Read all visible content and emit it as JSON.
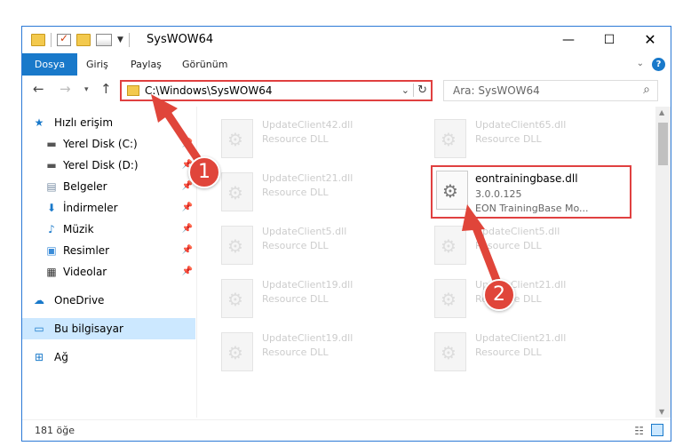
{
  "window": {
    "title": "SysWOW64"
  },
  "ribbon": {
    "tabs": [
      "Dosya",
      "Giriş",
      "Paylaş",
      "Görünüm"
    ],
    "help": "?"
  },
  "address": {
    "path": "C:\\Windows\\SysWOW64"
  },
  "search": {
    "placeholder": "Ara: SysWOW64"
  },
  "sidebar": {
    "items": [
      {
        "label": "Hızlı erişim",
        "icon": "star-icon"
      },
      {
        "label": "Yerel Disk (C:)",
        "icon": "drive-icon"
      },
      {
        "label": "Yerel Disk (D:)",
        "icon": "drive-icon"
      },
      {
        "label": "Belgeler",
        "icon": "documents-icon"
      },
      {
        "label": "İndirmeler",
        "icon": "download-icon"
      },
      {
        "label": "Müzik",
        "icon": "music-icon"
      },
      {
        "label": "Resimler",
        "icon": "pictures-icon"
      },
      {
        "label": "Videolar",
        "icon": "videos-icon"
      },
      {
        "label": "OneDrive",
        "icon": "cloud-icon"
      },
      {
        "label": "Bu bilgisayar",
        "icon": "computer-icon"
      },
      {
        "label": "Ağ",
        "icon": "network-icon"
      }
    ]
  },
  "files": [
    {
      "name": "UpdateClient42.dll",
      "desc": "Resource DLL"
    },
    {
      "name": "UpdateClient65.dll",
      "desc": "Resource DLL"
    },
    {
      "name": "UpdateClient21.dll",
      "desc": "Resource DLL"
    },
    {
      "name": "eontrainingbase.dll",
      "version": "3.0.0.125",
      "desc": "EON TrainingBase Mo..."
    },
    {
      "name": "UpdateClient5.dll",
      "desc": "Resource DLL"
    },
    {
      "name": "UpdateClient5.dll",
      "desc": "Resource DLL"
    },
    {
      "name": "UpdateClient19.dll",
      "desc": "Resource DLL"
    },
    {
      "name": "UpdateClient21.dll",
      "desc": "Resource DLL"
    },
    {
      "name": "UpdateClient19.dll",
      "desc": "Resource DLL"
    },
    {
      "name": "UpdateClient21.dll",
      "desc": "Resource DLL"
    }
  ],
  "status": {
    "count": "181 öğe"
  },
  "annotations": {
    "step1": "1",
    "step2": "2"
  },
  "colors": {
    "accent": "#1979ca",
    "highlight": "#e04040"
  }
}
